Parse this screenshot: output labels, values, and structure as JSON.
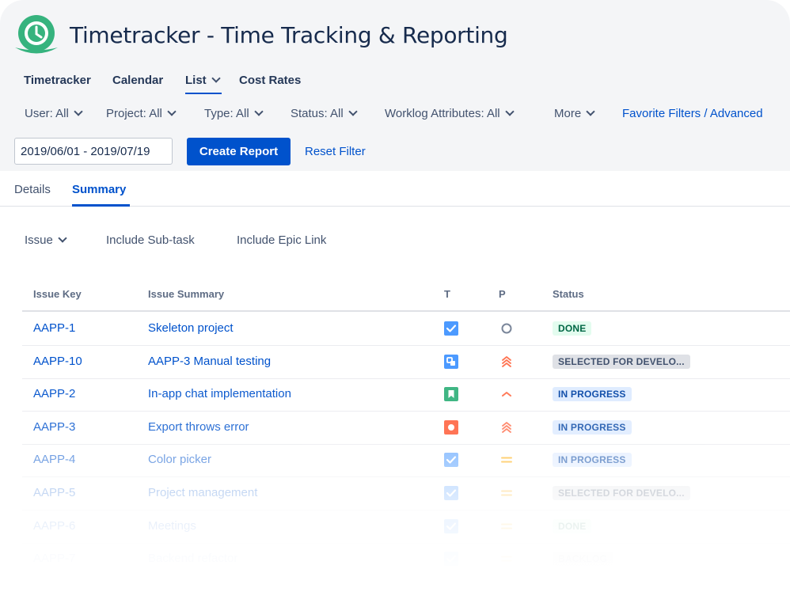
{
  "app": {
    "title": "Timetracker - Time Tracking & Reporting"
  },
  "nav": [
    "Timetracker",
    "Calendar",
    "List",
    "Cost Rates"
  ],
  "filters": {
    "user": "User: All",
    "project": "Project: All",
    "type": "Type: All",
    "status": "Status: All",
    "worklog": "Worklog Attributes: All",
    "more": "More",
    "favorite": "Favorite Filters / Advanced"
  },
  "date_range": "2019/06/01 - 2019/07/19",
  "actions": {
    "create": "Create Report",
    "reset": "Reset Filter"
  },
  "tabs": [
    "Details",
    "Summary"
  ],
  "grouping": {
    "issue": "Issue",
    "subtask": "Include Sub-task",
    "epic": "Include Epic Link"
  },
  "table": {
    "headers": [
      "Issue Key",
      "Issue Summary",
      "T",
      "P",
      "Status"
    ],
    "rows": [
      {
        "key": "AAPP-1",
        "summary": "Skeleton project",
        "type": "task",
        "priority": "lowest",
        "status": "DONE"
      },
      {
        "key": "AAPP-10",
        "summary": "AAPP-3 Manual testing",
        "type": "subtask",
        "priority": "highest",
        "status": "SELECTED FOR DEVELO..."
      },
      {
        "key": "AAPP-2",
        "summary": "In-app chat implementation",
        "type": "story",
        "priority": "high",
        "status": "IN PROGRESS"
      },
      {
        "key": "AAPP-3",
        "summary": "Export throws error",
        "type": "bug",
        "priority": "highest",
        "status": "IN PROGRESS"
      },
      {
        "key": "AAPP-4",
        "summary": "Color picker",
        "type": "task",
        "priority": "medium",
        "status": "IN PROGRESS"
      },
      {
        "key": "AAPP-5",
        "summary": "Project management",
        "type": "task",
        "priority": "medium",
        "status": "SELECTED FOR DEVELO..."
      },
      {
        "key": "AAPP-6",
        "summary": "Meetings",
        "type": "task",
        "priority": "medium",
        "status": "DONE"
      },
      {
        "key": "AAPP-7",
        "summary": "Backend refactor",
        "type": "task",
        "priority": "medium",
        "status": "BACKLOG"
      }
    ]
  },
  "colors": {
    "primary": "#0052cc",
    "logo": "#36b37e",
    "task": "#4c9aff",
    "bug": "#ff5630",
    "story": "#36b37e",
    "priority_high": "#ff7452",
    "priority_medium": "#ffab00"
  }
}
